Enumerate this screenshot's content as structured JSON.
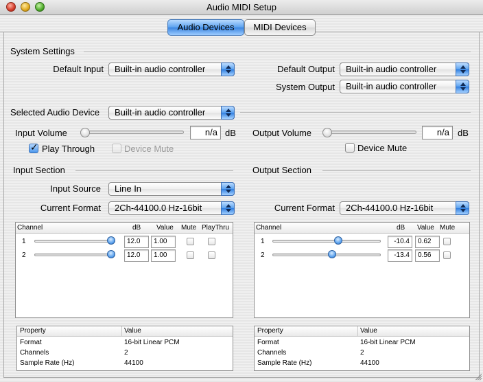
{
  "window": {
    "title": "Audio MIDI Setup"
  },
  "tabs": [
    {
      "label": "Audio Devices",
      "selected": true
    },
    {
      "label": "MIDI Devices",
      "selected": false
    }
  ],
  "system_settings": {
    "heading": "System Settings",
    "default_input_label": "Default Input",
    "default_input_value": "Built-in audio controller",
    "default_output_label": "Default Output",
    "default_output_value": "Built-in audio controller",
    "system_output_label": "System Output",
    "system_output_value": "Built-in audio controller"
  },
  "selected_device": {
    "label": "Selected Audio Device",
    "value": "Built-in audio controller"
  },
  "input_volume": {
    "label": "Input Volume",
    "value": "n/a",
    "unit": "dB",
    "level": 0
  },
  "output_volume": {
    "label": "Output Volume",
    "value": "n/a",
    "unit": "dB",
    "level": 0
  },
  "play_through": {
    "label": "Play Through",
    "checked": true
  },
  "input_device_mute": {
    "label": "Device Mute",
    "checked": false,
    "enabled": false
  },
  "output_device_mute": {
    "label": "Device Mute",
    "checked": false,
    "enabled": true
  },
  "input_section": {
    "heading": "Input Section",
    "source_label": "Input Source",
    "source_value": "Line In",
    "format_label": "Current Format",
    "format_value": "2Ch-44100.0 Hz-16bit",
    "channel_headers": {
      "channel": "Channel",
      "db": "dB",
      "value": "Value",
      "mute": "Mute",
      "playthru": "PlayThru"
    },
    "channels": [
      {
        "num": "1",
        "db": "12.0",
        "value": "1.00",
        "level": 1.0,
        "mute": false,
        "playthru": false
      },
      {
        "num": "2",
        "db": "12.0",
        "value": "1.00",
        "level": 1.0,
        "mute": false,
        "playthru": false
      }
    ],
    "properties_headers": {
      "property": "Property",
      "value": "Value"
    },
    "properties": [
      {
        "property": "Format",
        "value": "16-bit Linear PCM"
      },
      {
        "property": "Channels",
        "value": "2"
      },
      {
        "property": "Sample Rate (Hz)",
        "value": "44100"
      }
    ]
  },
  "output_section": {
    "heading": "Output Section",
    "format_label": "Current Format",
    "format_value": "2Ch-44100.0 Hz-16bit",
    "channel_headers": {
      "channel": "Channel",
      "db": "dB",
      "value": "Value",
      "mute": "Mute"
    },
    "channels": [
      {
        "num": "1",
        "db": "-10.4",
        "value": "0.62",
        "level": 0.62,
        "mute": false
      },
      {
        "num": "2",
        "db": "-13.4",
        "value": "0.56",
        "level": 0.56,
        "mute": false
      }
    ],
    "properties_headers": {
      "property": "Property",
      "value": "Value"
    },
    "properties": [
      {
        "property": "Format",
        "value": "16-bit Linear PCM"
      },
      {
        "property": "Channels",
        "value": "2"
      },
      {
        "property": "Sample Rate (Hz)",
        "value": "44100"
      }
    ]
  },
  "colors": {
    "accent_blue": "#5aa1ef",
    "window_bg": "#ececec"
  }
}
